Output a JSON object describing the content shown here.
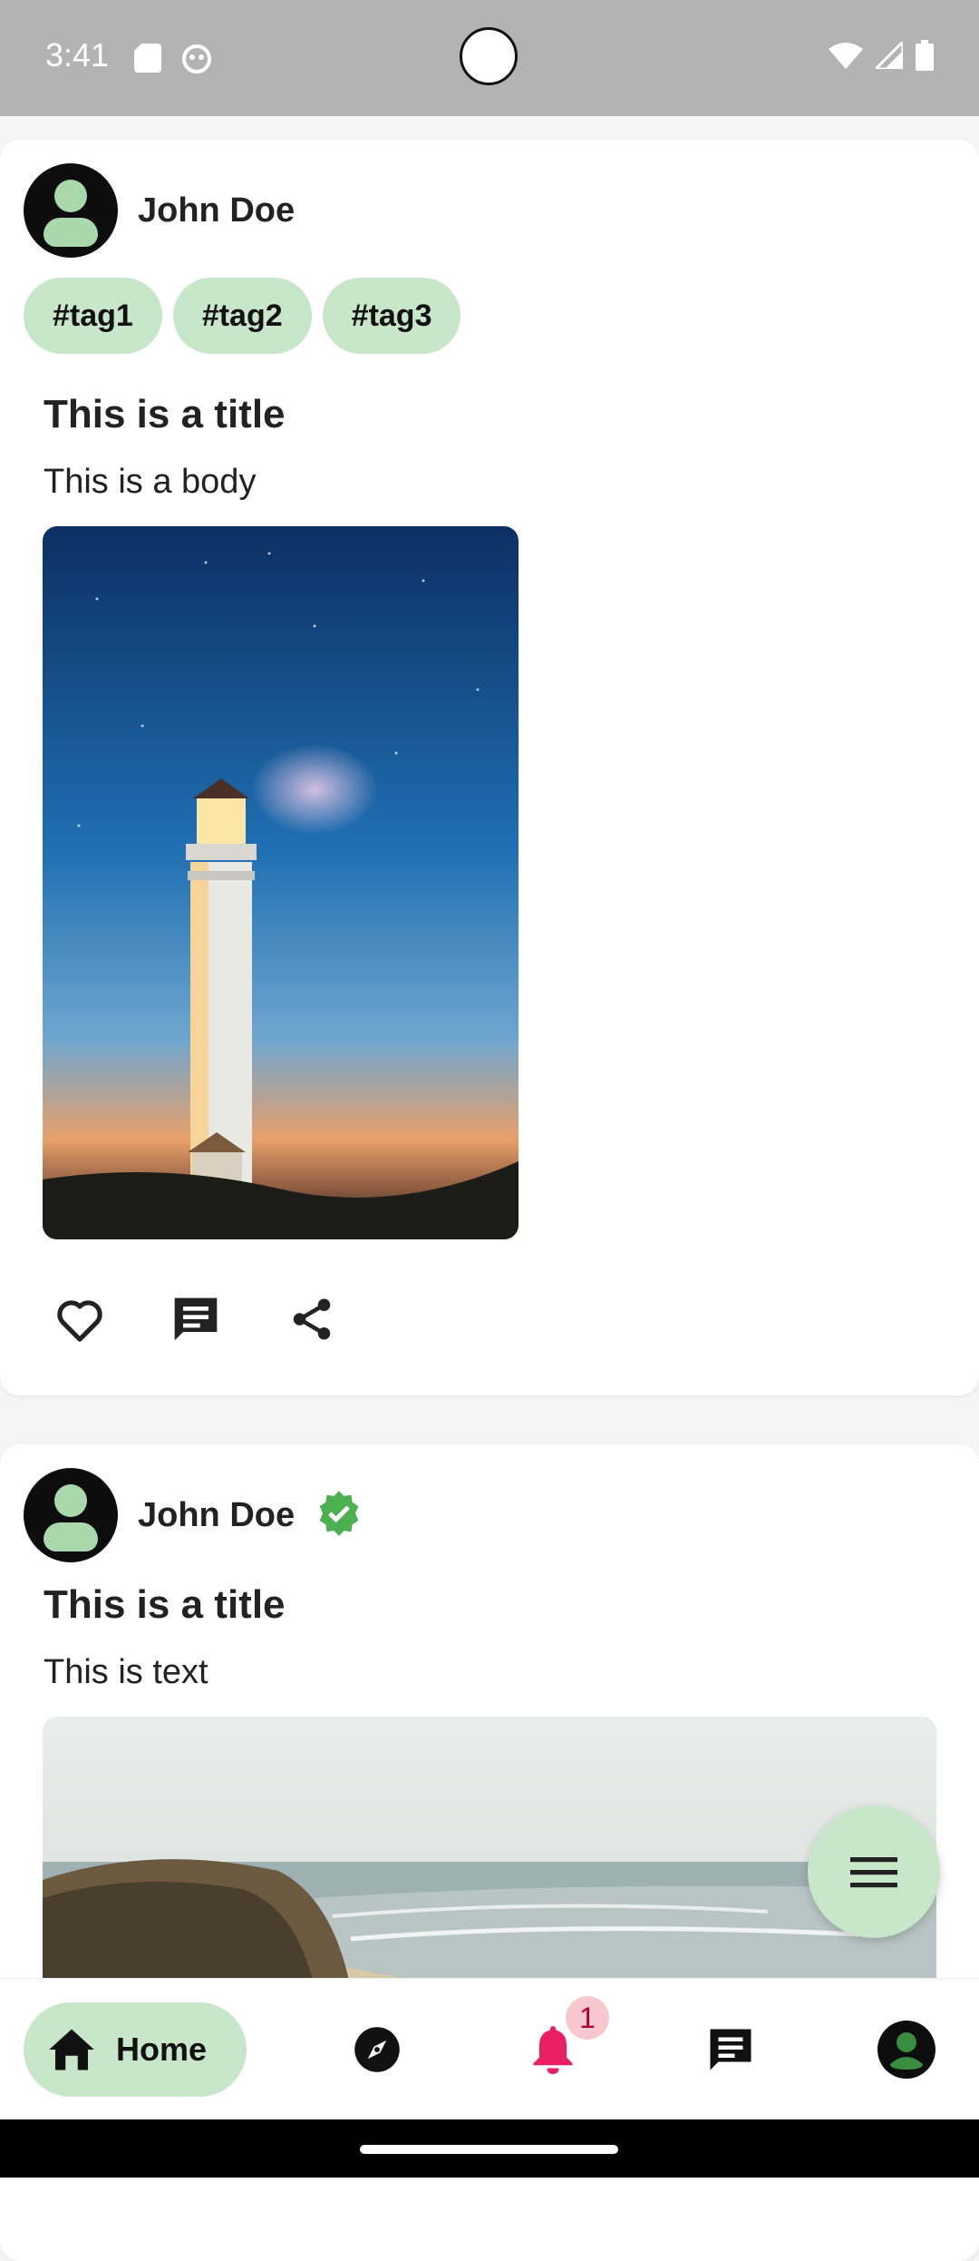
{
  "status_bar": {
    "time": "3:41",
    "icons": [
      "sd-card-icon",
      "android-debug-icon",
      "wifi-icon",
      "signal-icon",
      "battery-icon"
    ]
  },
  "posts": [
    {
      "author": "John Doe",
      "verified": false,
      "tags": [
        "#tag1",
        "#tag2",
        "#tag3"
      ],
      "title": "This is a title",
      "body": "This is a body",
      "image": "lighthouse at dusk"
    },
    {
      "author": "John Doe",
      "verified": true,
      "tags": [],
      "title": "This is a title",
      "body": "This is text",
      "image": "coastal beach cliffs"
    }
  ],
  "actions": [
    "heart-outline-icon",
    "comment-icon",
    "share-icon"
  ],
  "fab": {
    "icon": "menu-icon"
  },
  "nav": {
    "home_label": "Home",
    "items": [
      "home-icon",
      "compass-icon",
      "bell-icon",
      "chat-icon",
      "profile-icon"
    ],
    "notification_count": "1"
  },
  "colors": {
    "accent_light_green": "#c8e6c9",
    "verified_green": "#4caf50",
    "notification_pink": "#e91e63"
  }
}
